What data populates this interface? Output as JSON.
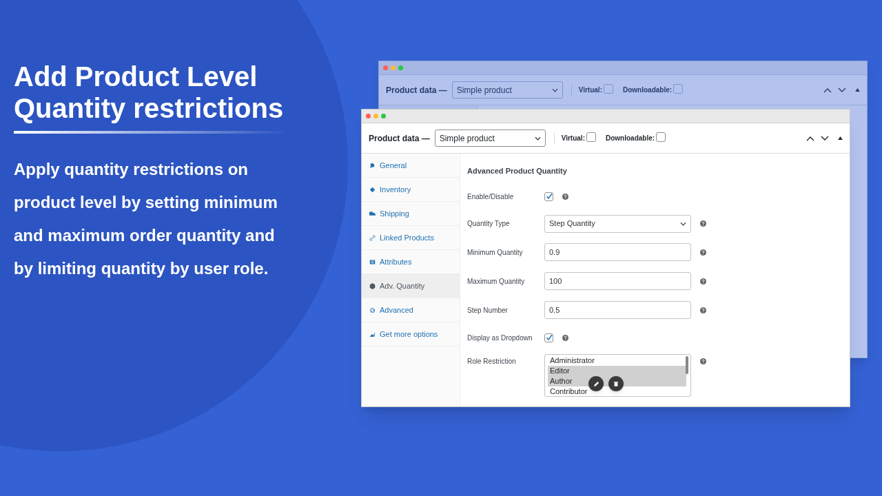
{
  "headline": "Add Product Level Quantity restrictions",
  "description": "Apply quantity restrictions on product level by setting minimum and maximum order quantity and by limiting quantity by user role.",
  "back_window": {
    "product_data_label": "Product data —",
    "product_type": "Simple product",
    "virtual": {
      "label": "Virtual:",
      "checked": false
    },
    "downloadable": {
      "label": "Downloadable:",
      "checked": false
    }
  },
  "front_window": {
    "product_data_label": "Product data —",
    "product_type": "Simple product",
    "virtual": {
      "label": "Virtual:",
      "checked": false
    },
    "downloadable": {
      "label": "Downloadable:",
      "checked": false
    },
    "tabs": [
      {
        "label": "General",
        "selected": false
      },
      {
        "label": "Inventory",
        "selected": false
      },
      {
        "label": "Shipping",
        "selected": false
      },
      {
        "label": "Linked Products",
        "selected": false
      },
      {
        "label": "Attributes",
        "selected": false
      },
      {
        "label": "Adv. Quantity",
        "selected": true
      },
      {
        "label": "Advanced",
        "selected": false
      },
      {
        "label": "Get more options",
        "selected": false
      }
    ],
    "section_title": "Advanced Product Quantity",
    "fields": [
      {
        "kind": "checkbox",
        "label": "Enable/Disable",
        "checked": true
      },
      {
        "kind": "select",
        "label": "Quantity Type",
        "value": "Step Quantity"
      },
      {
        "kind": "text",
        "label": "Minimum Quantity",
        "value": "0.9"
      },
      {
        "kind": "text",
        "label": "Maximum Quantity",
        "value": "100"
      },
      {
        "kind": "text",
        "label": "Step Number",
        "value": "0.5"
      },
      {
        "kind": "checkbox",
        "label": "Display as Dropdown",
        "checked": true
      },
      {
        "kind": "listbox",
        "label": "Role Restriction",
        "options": [
          {
            "label": "Administrator",
            "selected": false
          },
          {
            "label": "Editor",
            "selected": true
          },
          {
            "label": "Author",
            "selected": true
          },
          {
            "label": "Contributor",
            "selected": false
          }
        ]
      }
    ]
  }
}
